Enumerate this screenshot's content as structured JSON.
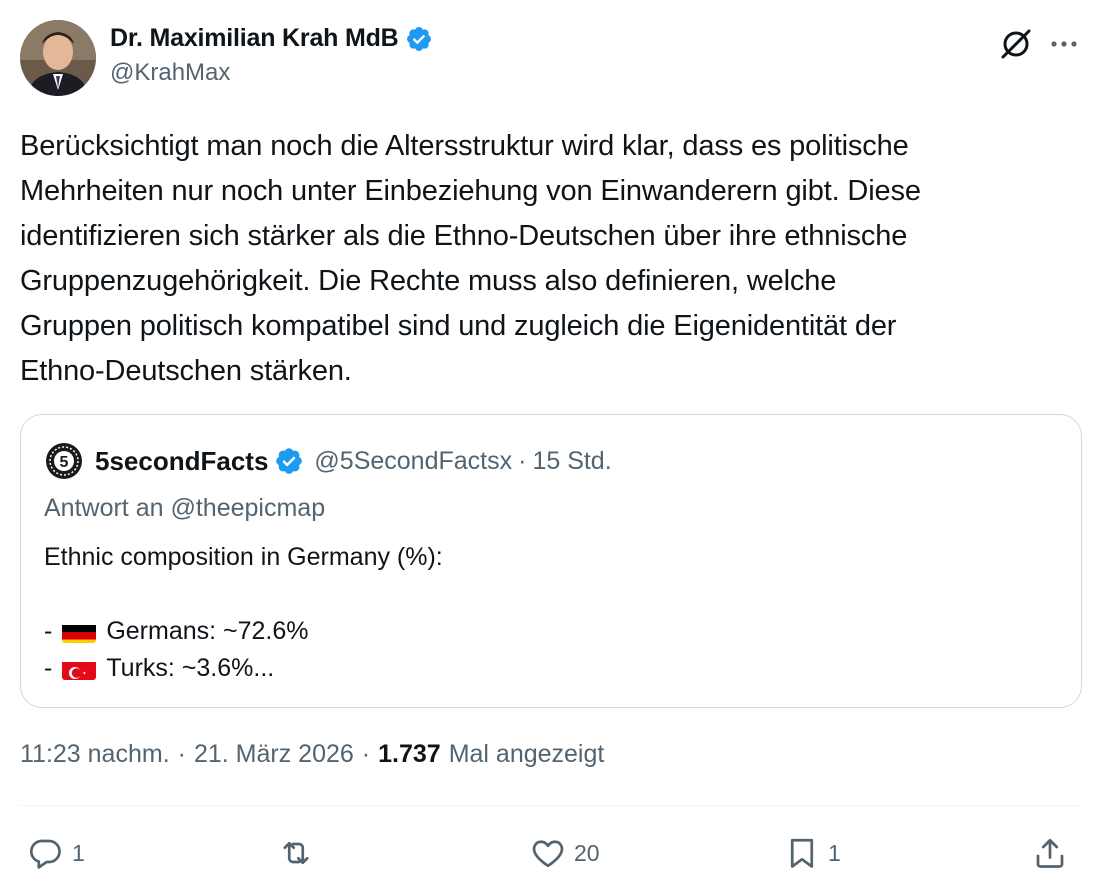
{
  "author": {
    "display_name": "Dr. Maximilian Krah MdB",
    "handle": "@KrahMax",
    "verified": true
  },
  "icons": {
    "avatar": "person-avatar",
    "verified": "verified-badge-icon",
    "grok": "grok-icon",
    "more": "more-icon"
  },
  "tweet": {
    "text": "Berücksichtigt man noch die Altersstruktur wird klar, dass es politische\nMehrheiten nur noch unter Einbeziehung von Einwanderern gibt. Diese\nidentifizieren sich stärker als die Ethno-Deutschen über ihre ethnische\nGruppenzugehörigkeit. Die Rechte muss also definieren, welche\nGruppen politisch kompatibel sind und zugleich die Eigenidentität der\nEthno-Deutschen stärken."
  },
  "quote": {
    "display_name": "5secondFacts",
    "handle": "@5SecondFactsx",
    "dot": "·",
    "time": "15 Std.",
    "reply_prefix": "Antwort an",
    "reply_handle": "@theepicmap",
    "body_title": "Ethnic composition in Germany (%):",
    "items": [
      {
        "dash": "-",
        "flag": "germany-flag",
        "text": "Germans: ~72.6%"
      },
      {
        "dash": "-",
        "flag": "turkey-flag",
        "text": "Turks: ~3.6%..."
      }
    ]
  },
  "meta": {
    "time": "11:23 nachm.",
    "dot1": "·",
    "date": "21. März 2026",
    "dot2": "·",
    "views": "1.737",
    "views_label": "Mal angezeigt"
  },
  "actions": {
    "reply_count": "1",
    "repost_count": "",
    "like_count": "20",
    "bookmark_count": "1"
  },
  "colors": {
    "text": "#0f1419",
    "secondary": "#536471",
    "verified_blue": "#1d9bf0",
    "border": "#cfd9de"
  }
}
